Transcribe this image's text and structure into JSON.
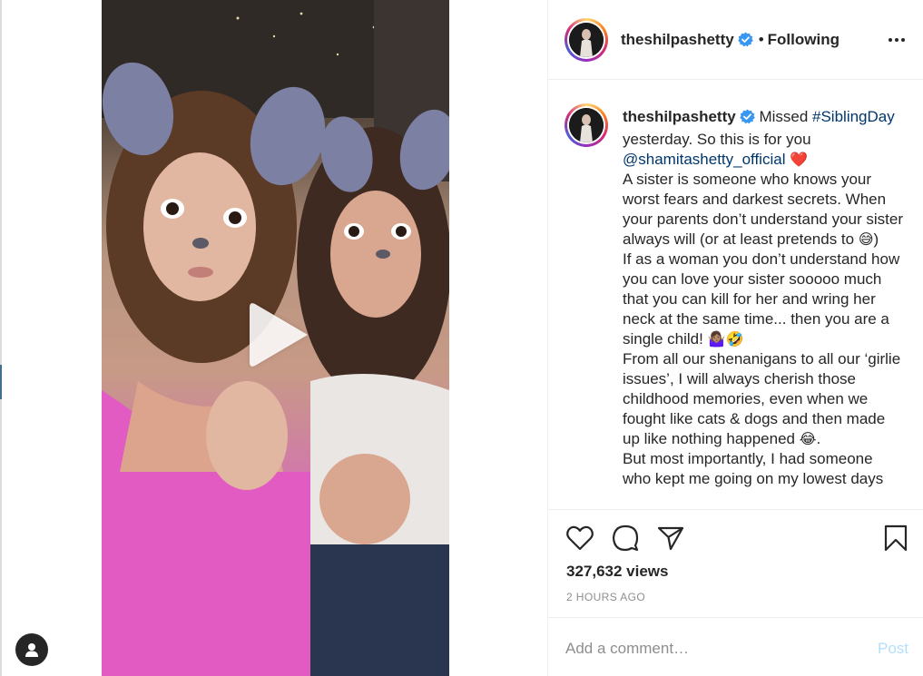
{
  "post": {
    "username": "theshilpashetty",
    "follow_status": "Following",
    "separator": "•"
  },
  "caption": {
    "username": "theshilpashetty",
    "part1": "Missed ",
    "hashtag": "#SiblingDay",
    "part2": " yesterday. So this is for you ",
    "mention": "@shamitashetty_official",
    "heart": "❤️",
    "para1": "A sister is someone who knows your worst fears and darkest secrets. When your parents don’t understand your sister always will (or at least pretends to ",
    "emoji1": "😅",
    "para1_end": ")",
    "para2": "If as a woman you don’t understand how you can love your sister sooooo much that you can kill for her and wring her neck at the same time... then you are a single child! ",
    "emoji2": "🤷🏽‍♀️🤣",
    "para3": "From all our shenanigans to all our ‘girlie issues’, I will always cherish those childhood memories, even when we fought like cats & dogs and then made up like nothing happened ",
    "emoji3": "😂",
    "para3_end": ".",
    "para4": "But most importantly, I had someone who kept me going on my lowest days"
  },
  "stats": {
    "views": "327,632 views",
    "time": "2 HOURS AGO"
  },
  "comment": {
    "placeholder": "Add a comment…",
    "post_label": "Post"
  },
  "colors": {
    "verified": "#3897f0",
    "link": "#00376b",
    "post_disabled": "#b2dffc",
    "heart_emoji": "#e0245e"
  }
}
